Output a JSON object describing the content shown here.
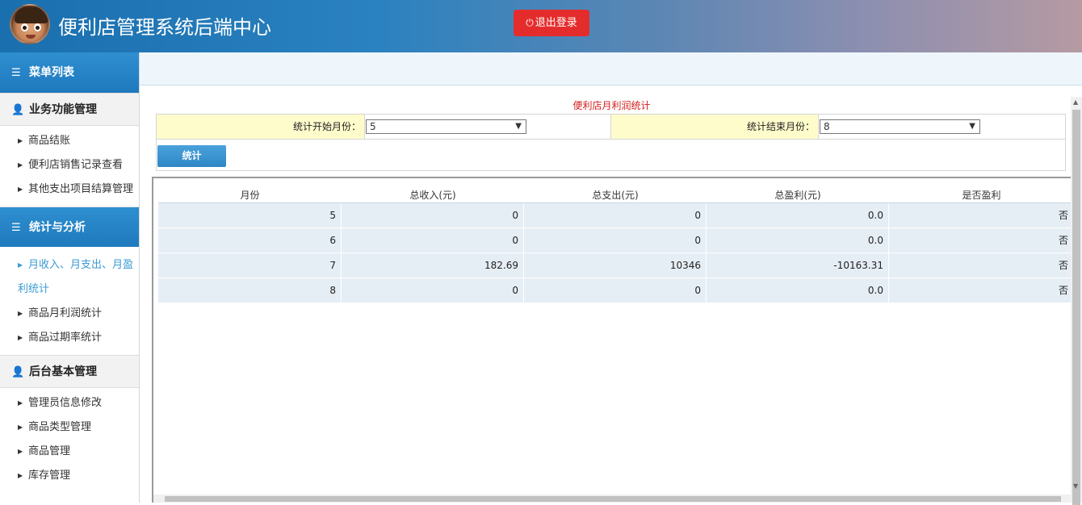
{
  "header": {
    "title": "便利店管理系统后端中心",
    "logout_label": "退出登录"
  },
  "sidebar": {
    "menu_header": "菜单列表",
    "sections": [
      {
        "title": "业务功能管理",
        "items": [
          "商品结账",
          "便利店销售记录查看",
          "其他支出项目结算管理"
        ]
      },
      {
        "title": "统计与分析",
        "items": [
          "月收入、月支出、月盈利统计",
          "商品月利润统计",
          "商品过期率统计"
        ]
      },
      {
        "title": "后台基本管理",
        "items": [
          "管理员信息修改",
          "商品类型管理",
          "商品管理",
          "库存管理"
        ]
      }
    ],
    "active_item": "月收入、月支出、月盈利统计"
  },
  "report": {
    "title": "便利店月利润统计",
    "start_label": "统计开始月份：",
    "start_value": "5",
    "end_label": "统计结束月份：",
    "end_value": "8",
    "submit_label": "统计"
  },
  "table": {
    "columns": [
      "月份",
      "总收入(元)",
      "总支出(元)",
      "总盈利(元)",
      "是否盈利"
    ],
    "rows": [
      [
        "5",
        "0",
        "0",
        "0.0",
        "否"
      ],
      [
        "6",
        "0",
        "0",
        "0.0",
        "否"
      ],
      [
        "7",
        "182.69",
        "10346",
        "-10163.31",
        "否"
      ],
      [
        "8",
        "0",
        "0",
        "0.0",
        "否"
      ]
    ]
  },
  "colors": {
    "header_gradient_start": "#1a6fae",
    "logout_button": "#e52c2c",
    "active_menu_text": "#3b9bd3",
    "report_title": "#d21e1e",
    "filter_label_bg": "#fffccc",
    "table_row_bg": "#e6eef5"
  }
}
